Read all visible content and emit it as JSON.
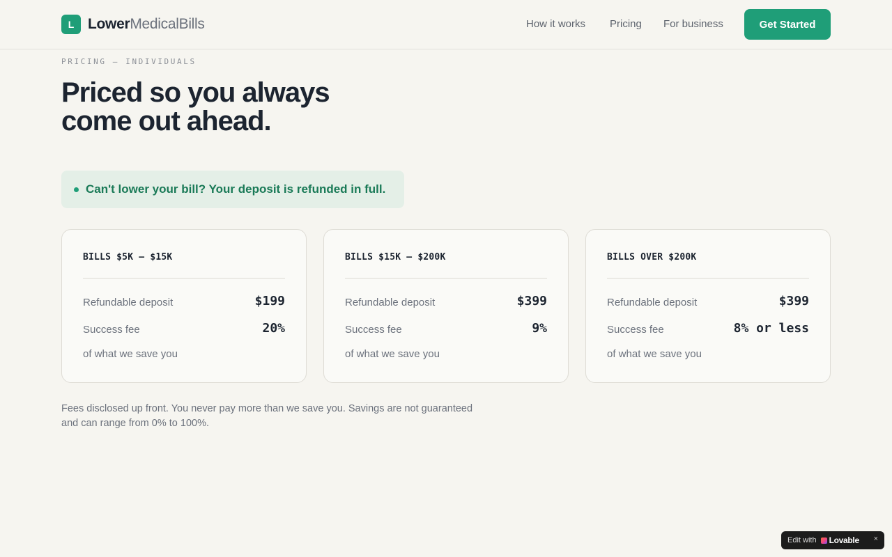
{
  "brand": {
    "badge": "L",
    "name_bold": "Lower",
    "name_light": "MedicalBills"
  },
  "nav": {
    "links": [
      "How it works",
      "Pricing",
      "For business"
    ],
    "cta": "Get Started"
  },
  "hero": {
    "eyebrow": "PRICING — INDIVIDUALS",
    "headline_line1": "Priced so you always",
    "headline_line2": "come out ahead."
  },
  "guarantee": {
    "text": "Can't lower your bill? Your deposit is refunded in full."
  },
  "plans": [
    {
      "title": "BILLS $5K – $15K",
      "deposit_label": "Refundable deposit",
      "deposit": "$199",
      "fee_label": "Success fee",
      "fee": "20%",
      "fee_note": "of what we save you"
    },
    {
      "title": "BILLS $15K – $200K",
      "deposit_label": "Refundable deposit",
      "deposit": "$399",
      "fee_label": "Success fee",
      "fee": "9%",
      "fee_note": "of what we save you"
    },
    {
      "title": "BILLS OVER $200K",
      "deposit_label": "Refundable deposit",
      "deposit": "$399",
      "fee_label": "Success fee",
      "fee": "8% or less",
      "fee_note": "of what we save you"
    }
  ],
  "footnote": {
    "line1": "Fees disclosed up front. You never pay more than we save you. Savings are not guaranteed",
    "line2": "and can range from 0% to 100%."
  },
  "lovable_badge": {
    "prefix": "Edit with",
    "brand": "Lovable",
    "close": "×"
  },
  "colors": {
    "accent": "#1f9e78",
    "background": "#f6f5f0",
    "guarantee_bg": "#e4efe7",
    "guarantee_text": "#1a7a57"
  }
}
